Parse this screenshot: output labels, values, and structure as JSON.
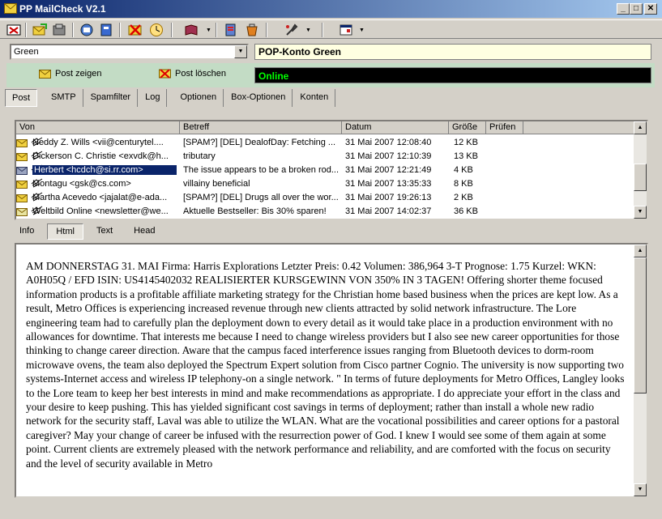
{
  "window": {
    "title": "PP MailCheck V2.1",
    "min": "_",
    "max": "□",
    "close": "✕"
  },
  "toolbar": {
    "icons": [
      "close-window-icon",
      "check-mail-icon",
      "stop-icon",
      "send-icon",
      "address-icon",
      "delete-mail-icon",
      "clock-icon",
      "book-icon",
      "spam-filter-icon",
      "bucket-icon",
      "settings-icon",
      "window-view-icon"
    ]
  },
  "account": {
    "selected": "Green",
    "label": "POP-Konto Green",
    "status": "Online",
    "show_mail": "Post zeigen",
    "delete_mail": "Post löschen"
  },
  "main_tabs": [
    "Post",
    "SMTP",
    "Spamfilter",
    "Log",
    "Optionen",
    "Box-Optionen",
    "Konten"
  ],
  "list": {
    "columns": [
      "Von",
      "Betreff",
      "Datum",
      "Größe",
      "Prüfen"
    ],
    "rows": [
      {
        "from": "Neddy Z. Wills <vii@centurytel....",
        "subject": "[SPAM?] [DEL] DealofDay: Fetching ...",
        "date": "31 Mai 2007 12:08:40",
        "size": "12 KB"
      },
      {
        "from": "Dickerson C. Christie <exvdk@h...",
        "subject": "tributary",
        "date": "31 Mai 2007 12:10:39",
        "size": "13 KB"
      },
      {
        "from": "Herbert <hcdch@si.rr.com>",
        "subject": "The issue appears to be a broken rod...",
        "date": "31 Mai 2007 12:21:49",
        "size": "4 KB"
      },
      {
        "from": "Montagu <gsk@cs.com>",
        "subject": "villainy beneficial",
        "date": "31 Mai 2007 13:35:33",
        "size": "8 KB"
      },
      {
        "from": "Martha Acevedo <jajalat@e-ada...",
        "subject": "[SPAM?] [DEL] Drugs all over the wor...",
        "date": "31 Mai 2007 19:26:13",
        "size": "2 KB"
      },
      {
        "from": "Weltbild Online <newsletter@we...",
        "subject": "Aktuelle Bestseller: Bis 30% sparen!",
        "date": "31 Mai 2007 14:02:37",
        "size": "36 KB"
      }
    ]
  },
  "view_tabs": [
    "Info",
    "Html",
    "Text",
    "Head"
  ],
  "body_text": "AM DONNERSTAG 31. MAI Firma: Harris Explorations Letzter Preis: 0.42 Volumen: 386,964 3-T Prognose: 1.75 Kurzel: WKN: A0H05Q / EFD ISIN: US4145402032 REALISIERTER KURSGEWINN VON 350% IN 3 TAGEN! Offering shorter theme focused information products is a profitable affiliate marketing strategy for the Christian home based business when the prices are kept low. As a result, Metro Offices is experiencing increased revenue through new clients attracted by solid network infrastructure. The Lore engineering team had to carefully plan the deployment down to every detail as it would take place in a production environment with no allowances for downtime. That interests me because I need to change wireless providers but I also see new career opportunities for those thinking to change career direction. Aware that the campus faced interference issues ranging from Bluetooth devices to dorm-room microwave ovens, the team also deployed the Spectrum Expert solution from Cisco partner Cognio. The university is now supporting two systems-Internet access and wireless IP telephony-on a single network. \" In terms of future deployments for Metro Offices, Langley looks to the Lore team to keep her best interests in mind and make recommendations as appropriate. I do appreciate your effort in the class and your desire to keep pushing. This has yielded significant cost savings in terms of deployment; rather than install a whole new radio network for the security staff, Laval was able to utilize the WLAN. What are the vocational possibilities and career options for a pastoral caregiver? May your change of career be infused with the resurrection power of God. I knew I would see some of them again at some point. Current clients are extremely pleased with the network performance and reliability, and are comforted with the focus on security and the level of security available in Metro"
}
